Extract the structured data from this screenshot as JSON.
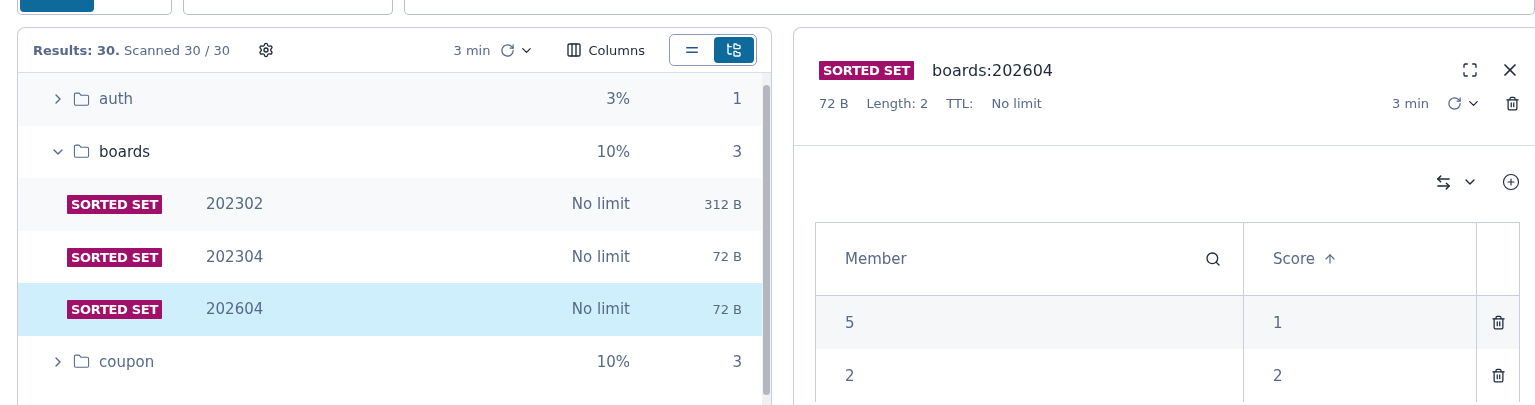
{
  "browser": {
    "summary": "Results: 30.",
    "scanned": "Scanned 30 / 30",
    "refresh_interval": "3 min",
    "columns_button": "Columns",
    "views": [
      {
        "kind": "list",
        "selected": false
      },
      {
        "kind": "tree",
        "selected": true
      }
    ],
    "rows": [
      {
        "kind": "folder",
        "name": "auth",
        "expanded": false,
        "percent": "3%",
        "count": "1",
        "selected": false
      },
      {
        "kind": "folder",
        "name": "boards",
        "expanded": true,
        "percent": "10%",
        "count": "3",
        "selected": false
      },
      {
        "kind": "key",
        "type": "SORTED SET",
        "name": "202302",
        "ttl": "No limit",
        "size": "312 B",
        "selected": false
      },
      {
        "kind": "key",
        "type": "SORTED SET",
        "name": "202304",
        "ttl": "No limit",
        "size": "72 B",
        "selected": false
      },
      {
        "kind": "key",
        "type": "SORTED SET",
        "name": "202604",
        "ttl": "No limit",
        "size": "72 B",
        "selected": true
      },
      {
        "kind": "folder",
        "name": "coupon",
        "expanded": false,
        "percent": "10%",
        "count": "3",
        "selected": false
      }
    ]
  },
  "details": {
    "type": "SORTED SET",
    "key": "boards:202604",
    "size": "72 B",
    "length": "Length: 2",
    "ttl_label": "TTL:",
    "ttl": "No limit",
    "refresh_interval": "3 min",
    "table": {
      "columns": [
        "Member",
        "Score"
      ],
      "rows": [
        {
          "member": "5",
          "score": "1"
        },
        {
          "member": "2",
          "score": "2"
        }
      ]
    }
  }
}
